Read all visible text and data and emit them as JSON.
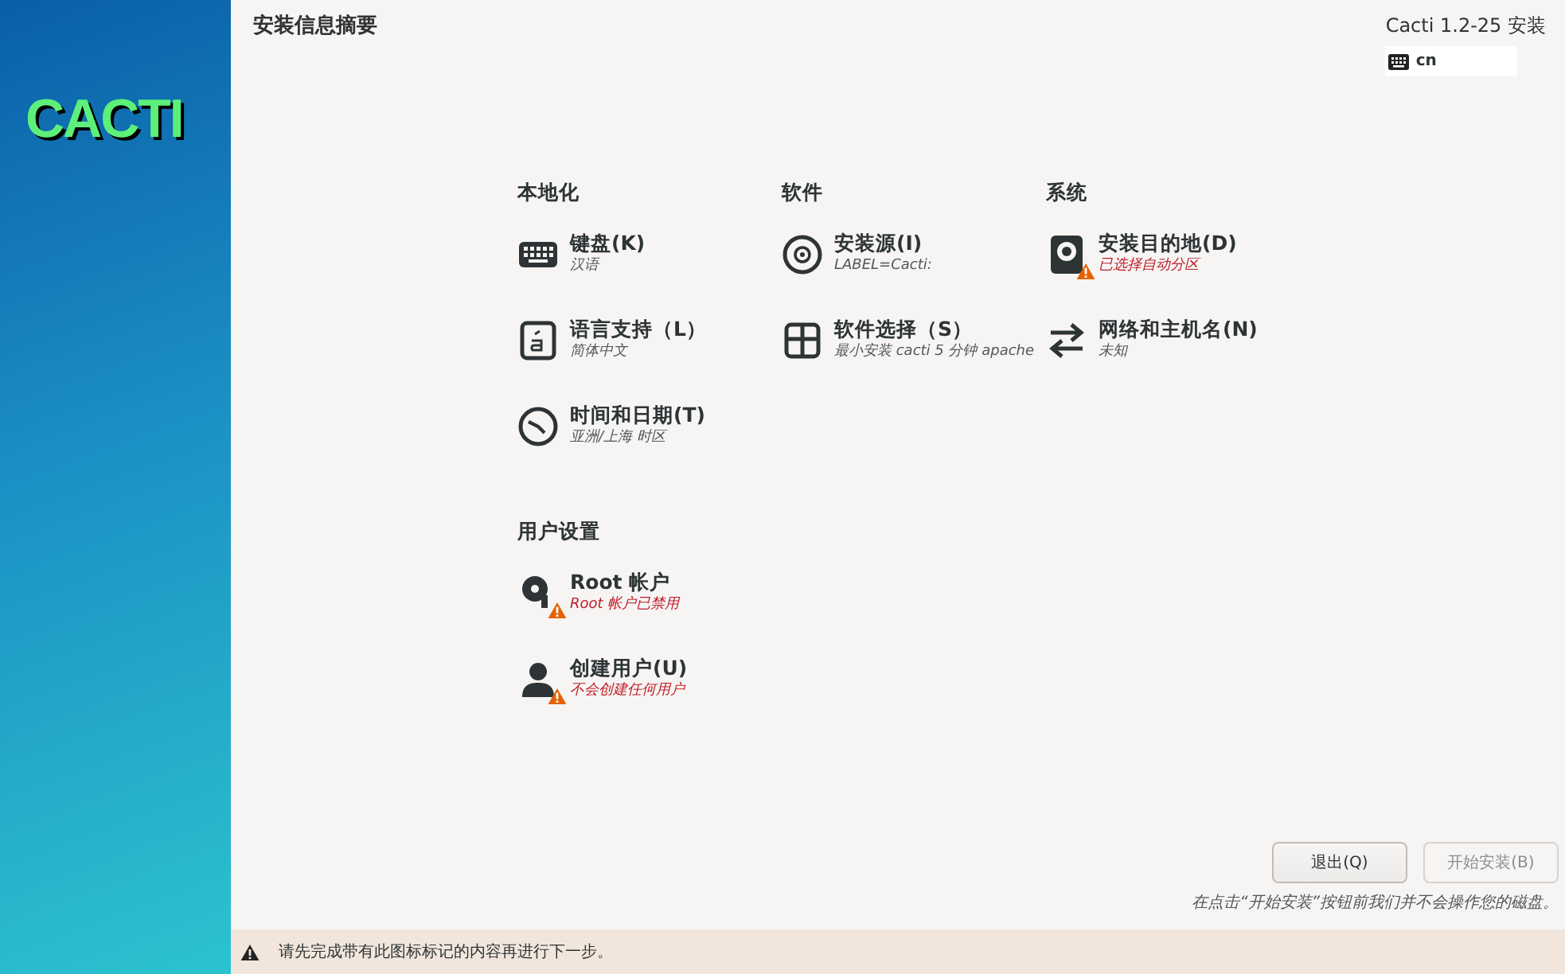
{
  "sidebar": {
    "logo": "CACTI"
  },
  "header": {
    "title": "安装信息摘要",
    "product": "Cacti 1.2-25 安装",
    "keyboard_layout": "cn"
  },
  "sections": [
    {
      "title": "本地化",
      "items": [
        {
          "kind": "keyboard",
          "title": "键盘(K)",
          "status": "汉语",
          "warning": false
        },
        {
          "kind": "language",
          "title": "语言支持（L）",
          "status": "简体中文",
          "warning": false
        },
        {
          "kind": "clock",
          "title": "时间和日期(T)",
          "status": "亚洲/上海 时区",
          "warning": false
        }
      ]
    },
    {
      "title": "软件",
      "items": [
        {
          "kind": "disc",
          "title": "安装源(I)",
          "status": "LABEL=Cacti:",
          "warning": false
        },
        {
          "kind": "package",
          "title": "软件选择（S）",
          "status": "最小安装 cacti 5 分钟 apache",
          "warning": false
        }
      ]
    },
    {
      "title": "系统",
      "items": [
        {
          "kind": "disk",
          "title": "安装目的地(D)",
          "status": "已选择自动分区",
          "warning": true
        },
        {
          "kind": "network",
          "title": "网络和主机名(N)",
          "status": "未知",
          "warning": false
        }
      ]
    },
    {
      "title": "用户设置",
      "items": [
        {
          "kind": "key",
          "title": "Root 帐户",
          "status": "Root 帐户已禁用",
          "warning": true
        },
        {
          "kind": "user",
          "title": "创建用户(U)",
          "status": "不会创建任何用户",
          "warning": true
        }
      ]
    }
  ],
  "buttons": [
    {
      "label": "退出(Q)",
      "disabled": false
    },
    {
      "label": "开始安装(B)",
      "disabled": true
    }
  ],
  "note": "在点击“开始安装”按钮前我们并不会操作您的磁盘。",
  "warning_bar": {
    "text": "请先完成带有此图标标记的内容再进行下一步。"
  }
}
